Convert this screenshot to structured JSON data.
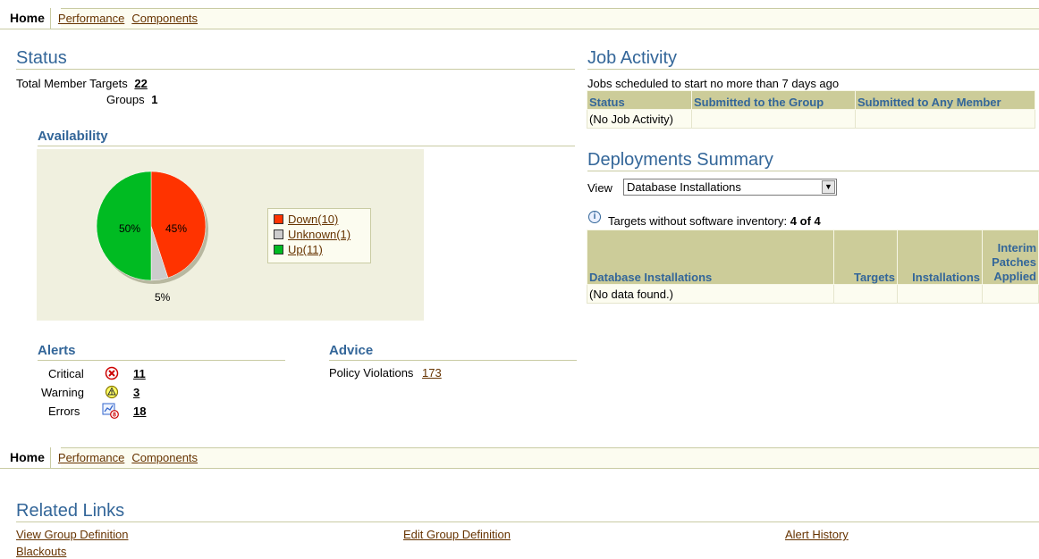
{
  "tabs": {
    "home": "Home",
    "performance": "Performance",
    "components": "Components"
  },
  "status": {
    "title": "Status",
    "total_label": "Total Member Targets",
    "total_value": "22",
    "groups_label": "Groups",
    "groups_value": "1"
  },
  "availability": {
    "title": "Availability",
    "legend": [
      {
        "label": "Down(10)",
        "color": "#ff3300"
      },
      {
        "label": "Unknown(1)",
        "color": "#cccccc"
      },
      {
        "label": "Up(11)",
        "color": "#00bb22"
      }
    ],
    "pie_labels": {
      "down": "45%",
      "unknown": "5%",
      "up": "50%"
    }
  },
  "chart_data": {
    "type": "pie",
    "categories": [
      "Down",
      "Unknown",
      "Up"
    ],
    "values": [
      45,
      5,
      50
    ],
    "counts": [
      10,
      1,
      11
    ],
    "colors": [
      "#ff3300",
      "#cccccc",
      "#00bb22"
    ]
  },
  "alerts": {
    "title": "Alerts",
    "critical_label": "Critical",
    "critical_value": "11",
    "warning_label": "Warning",
    "warning_value": "3",
    "errors_label": "Errors",
    "errors_value": "18"
  },
  "advice": {
    "title": "Advice",
    "policy_label": "Policy Violations",
    "policy_value": "173"
  },
  "job_activity": {
    "title": "Job Activity",
    "caption": "Jobs scheduled to start no more than 7 days ago",
    "headers": [
      "Status",
      "Submitted to the Group",
      "Submitted to Any Member"
    ],
    "empty_row": "(No Job Activity)"
  },
  "deployments": {
    "title": "Deployments Summary",
    "view_label": "View",
    "view_value": "Database Installations",
    "inventory_label": "Targets without software inventory:",
    "inventory_value": "4 of 4",
    "headers": [
      "Database Installations",
      "Targets",
      "Installations",
      "Interim Patches Applied"
    ],
    "empty_row": "(No data found.)"
  },
  "related": {
    "title": "Related Links",
    "links": [
      "View Group Definition",
      "Edit Group Definition",
      "Alert History",
      "Blackouts"
    ]
  }
}
